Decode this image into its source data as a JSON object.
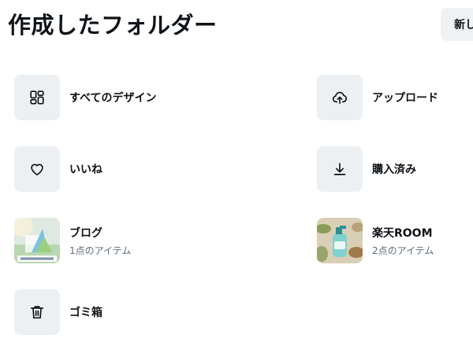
{
  "header": {
    "title": "作成したフォルダー",
    "new_button_label": "新し"
  },
  "folders": [
    {
      "label": "すべてのデザイン",
      "icon": "grid-icon"
    },
    {
      "label": "アップロード",
      "icon": "cloud-upload-icon"
    },
    {
      "label": "いいね",
      "icon": "heart-icon"
    },
    {
      "label": "購入済み",
      "icon": "download-icon"
    },
    {
      "label": "ブログ",
      "count": "1点のアイテム",
      "icon": "blog-thumbnail"
    },
    {
      "label": "楽天ROOM",
      "count": "2点のアイテム",
      "icon": "rakuten-room-thumbnail"
    },
    {
      "label": "ゴミ箱",
      "icon": "trash-icon"
    }
  ]
}
